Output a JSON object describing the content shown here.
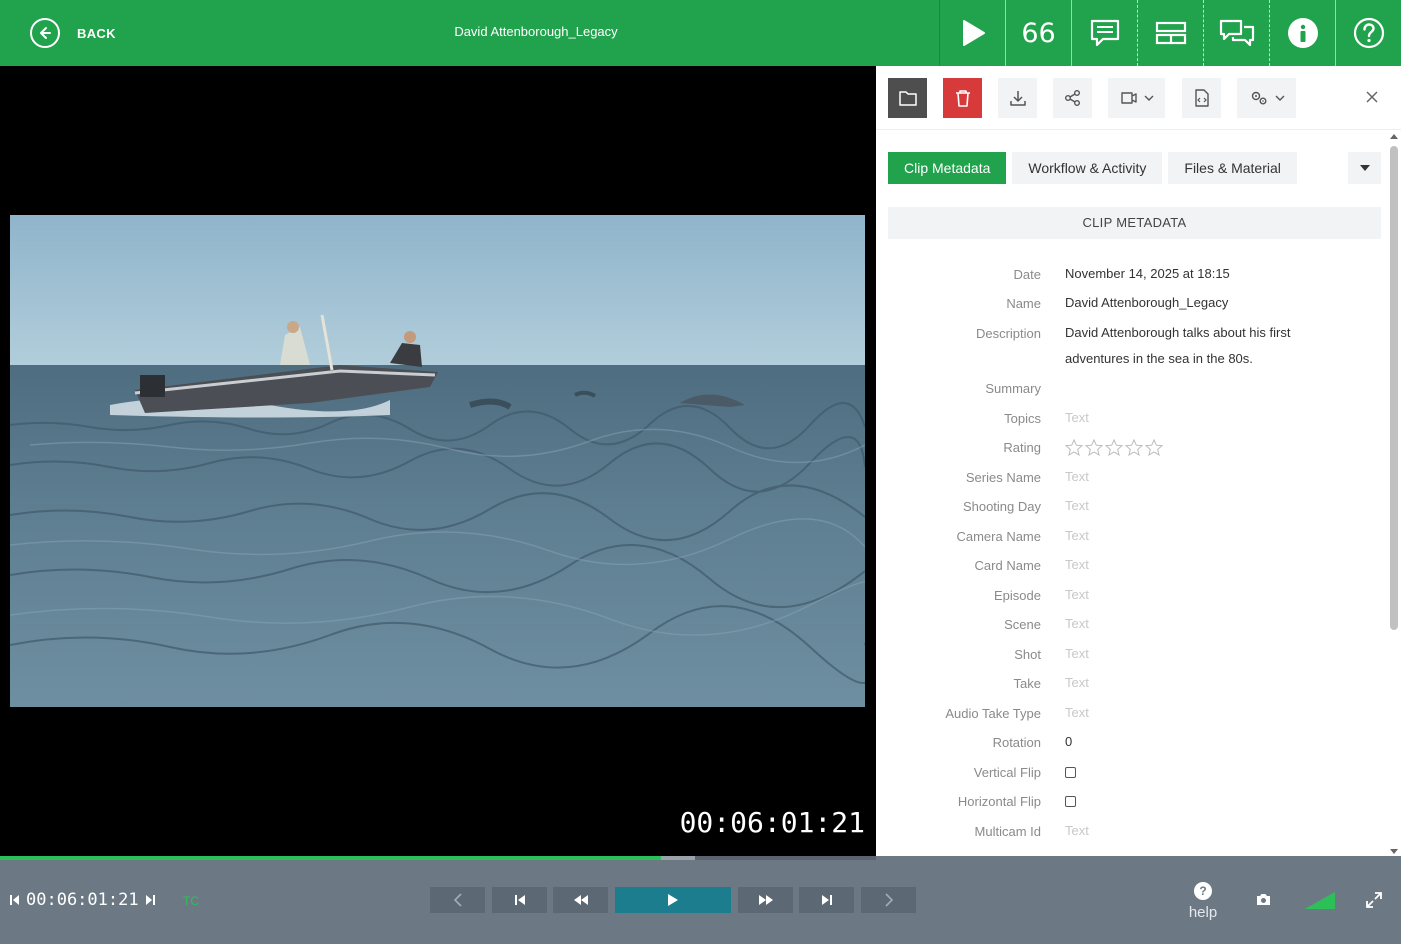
{
  "header": {
    "back_label": "BACK",
    "title": "David Attenborough_Legacy",
    "comment_count": "66",
    "buttons": [
      "play-icon",
      "quote-icon",
      "message-icon",
      "layout-icon",
      "chat-icon",
      "info-icon",
      "help-icon"
    ]
  },
  "video": {
    "timecode_overlay": "00:06:01:21",
    "progress_fraction": 0.755
  },
  "controls": {
    "current_timecode": "00:06:01:21",
    "tc_label": "TC",
    "help_label": "help"
  },
  "panel": {
    "tabs": [
      {
        "label": "Clip Metadata",
        "active": true
      },
      {
        "label": "Workflow & Activity",
        "active": false
      },
      {
        "label": "Files & Material",
        "active": false
      }
    ],
    "section_title": "CLIP METADATA",
    "fields": {
      "date": {
        "label": "Date",
        "value": "November 14, 2025 at 18:15"
      },
      "name": {
        "label": "Name",
        "value": "David Attenborough_Legacy"
      },
      "description": {
        "label": "Description",
        "value": "David Attenborough talks about his first adventures in the sea in the 80s."
      },
      "summary": {
        "label": "Summary",
        "value": ""
      },
      "topics": {
        "label": "Topics",
        "placeholder": "Text"
      },
      "rating": {
        "label": "Rating",
        "stars": 0,
        "max": 5
      },
      "series_name": {
        "label": "Series Name",
        "placeholder": "Text"
      },
      "shooting_day": {
        "label": "Shooting Day",
        "placeholder": "Text"
      },
      "camera_name": {
        "label": "Camera Name",
        "placeholder": "Text"
      },
      "card_name": {
        "label": "Card Name",
        "placeholder": "Text"
      },
      "episode": {
        "label": "Episode",
        "placeholder": "Text"
      },
      "scene": {
        "label": "Scene",
        "placeholder": "Text"
      },
      "shot": {
        "label": "Shot",
        "placeholder": "Text"
      },
      "take": {
        "label": "Take",
        "placeholder": "Text"
      },
      "audio_take_type": {
        "label": "Audio Take Type",
        "placeholder": "Text"
      },
      "rotation": {
        "label": "Rotation",
        "value": "0"
      },
      "vertical_flip": {
        "label": "Vertical Flip",
        "checked": false
      },
      "horizontal_flip": {
        "label": "Horizontal Flip",
        "checked": false
      },
      "multicam_id": {
        "label": "Multicam Id",
        "placeholder": "Text"
      }
    }
  },
  "colors": {
    "brand_green": "#21a24c",
    "delete_red": "#d63a3a",
    "control_bar": "#6c7985",
    "play_teal": "#1c7d8e"
  }
}
